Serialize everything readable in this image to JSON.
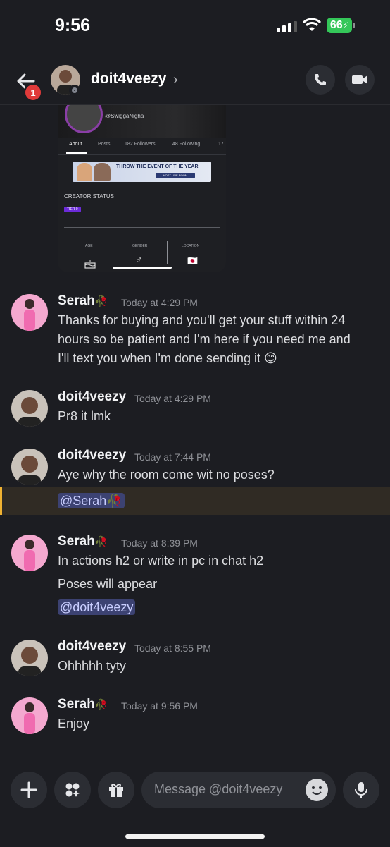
{
  "status_bar": {
    "time": "9:56",
    "battery": "66"
  },
  "header": {
    "title": "doit4veezy",
    "unread_badge": "1",
    "chevron": "›"
  },
  "shared_image": {
    "handle": "@SwiggaNigha",
    "tabs": [
      "About",
      "Posts",
      "182 Followers",
      "48 Following",
      "17"
    ],
    "banner_text": "THROW THE EVENT OF THE YEAR",
    "banner_pill": "HOST LIVE ROOM",
    "creator_status": "CREATOR STATUS",
    "tier": "TIER 0",
    "columns": [
      "AGE",
      "GENDER",
      "LOCATION"
    ],
    "gender_symbol": "♂",
    "location_flag": "🇯🇵",
    "age_icon": "cake-icon"
  },
  "messages": [
    {
      "author": "Serah",
      "time": "Today at 4:29 PM",
      "lines": [
        "Thanks for buying and you'll get your stuff within 24",
        "hours so be patient and I'm here if you need me and",
        "I'll text you when I'm done sending it 😊"
      ]
    },
    {
      "author": "doit4veezy",
      "time": "Today at 4:29 PM",
      "lines": [
        "Pr8 it lmk"
      ]
    },
    {
      "author": "doit4veezy",
      "time": "Today at 7:44 PM",
      "lines": [
        "Aye why the room come wit no poses?"
      ],
      "mention": "@Serah🥀"
    },
    {
      "author": "Serah",
      "time": "Today at 8:39 PM",
      "lines": [
        "In actions h2 or write in pc in chat h2",
        "Poses will appear"
      ],
      "mention": "@doit4veezy"
    },
    {
      "author": "doit4veezy",
      "time": "Today at 8:55 PM",
      "lines": [
        "Ohhhhh tyty"
      ]
    },
    {
      "author": "Serah",
      "time": "Today at 9:56 PM",
      "lines": [
        "Enjoy"
      ]
    }
  ],
  "author_suffix": {
    "Serah": "🥀"
  },
  "composer": {
    "placeholder": "Message @doit4veezy"
  }
}
